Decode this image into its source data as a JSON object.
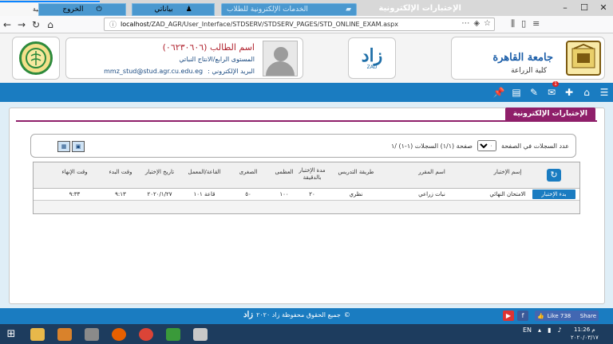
{
  "browser": {
    "tab_title": "الإختبارات الإلكترونية",
    "url_host": "localhost",
    "url_path": "/ZAD_AGR/User_Interface/STDSERV/STDSERV_PAGES/STD_ONLINE_EXAM.aspx"
  },
  "header": {
    "university_name": "جامعة القاهرة",
    "faculty_name": "كلية الزراعة",
    "zad_logo": "زاد",
    "zad_sub": "ZAD",
    "student_name": "اسم الطالب (٠٦٢٣٠٦٠٦)",
    "student_level": "المستوى الرابع/الانتاج النباتي",
    "email_label": "البريد الإلكتروني :",
    "email": "mmz_stud@stud.agr.cu.edu.eg"
  },
  "menu": {
    "title": "الإختبارات الإلكترونية",
    "services": "الخدمات الإلكترونية للطلاب",
    "profile": "بياناتي",
    "logout": "الخروج",
    "notification_count": "1"
  },
  "page": {
    "title": "الإختبارات الإلكترونية",
    "records_per_page_label": "عدد السجلات في الصفحة",
    "records_per_page": "١٠",
    "page_info": "صفحة (١/١) السجلات (١-١) /١"
  },
  "table": {
    "headers": {
      "exam": "إسم الإختبار",
      "course": "اسم المقرر",
      "teaching_method": "طريقة التدريس",
      "duration": "مدة الإختبار بالدقيقة",
      "max": "العظمى",
      "min": "الصغرى",
      "hall": "القاعة/المعمل",
      "date": "تاريخ الإختبار",
      "start": "وقت البدء",
      "end": "وقت الإنهاء"
    },
    "rows": [
      {
        "action": "بدء الإختبار",
        "exam": "الامتحان النهائي",
        "course": "نبات زراعي",
        "teaching_method": "نظري",
        "duration": "٢٠",
        "max": "١٠٠",
        "min": "٥٠",
        "hall": "قاعة ١٠١",
        "date": "٢٠٢٠/١/٢٧",
        "start": "٩:١٣",
        "end": "٩:٣٣"
      }
    ]
  },
  "footer": {
    "copyright": "جميع الحقوق محفوظة زاد ٢٠٢٠",
    "zad_mini": "زاد",
    "fb_like": "Like 738",
    "fb_share": "Share"
  },
  "taskbar": {
    "lang": "EN",
    "time": "11:26 م",
    "date": "٢٠٢٠/٠٣/١٧"
  },
  "colors": {
    "primary": "#1a7cc1",
    "title_tab": "#8f1f6a",
    "student_name": "#b0222e"
  }
}
